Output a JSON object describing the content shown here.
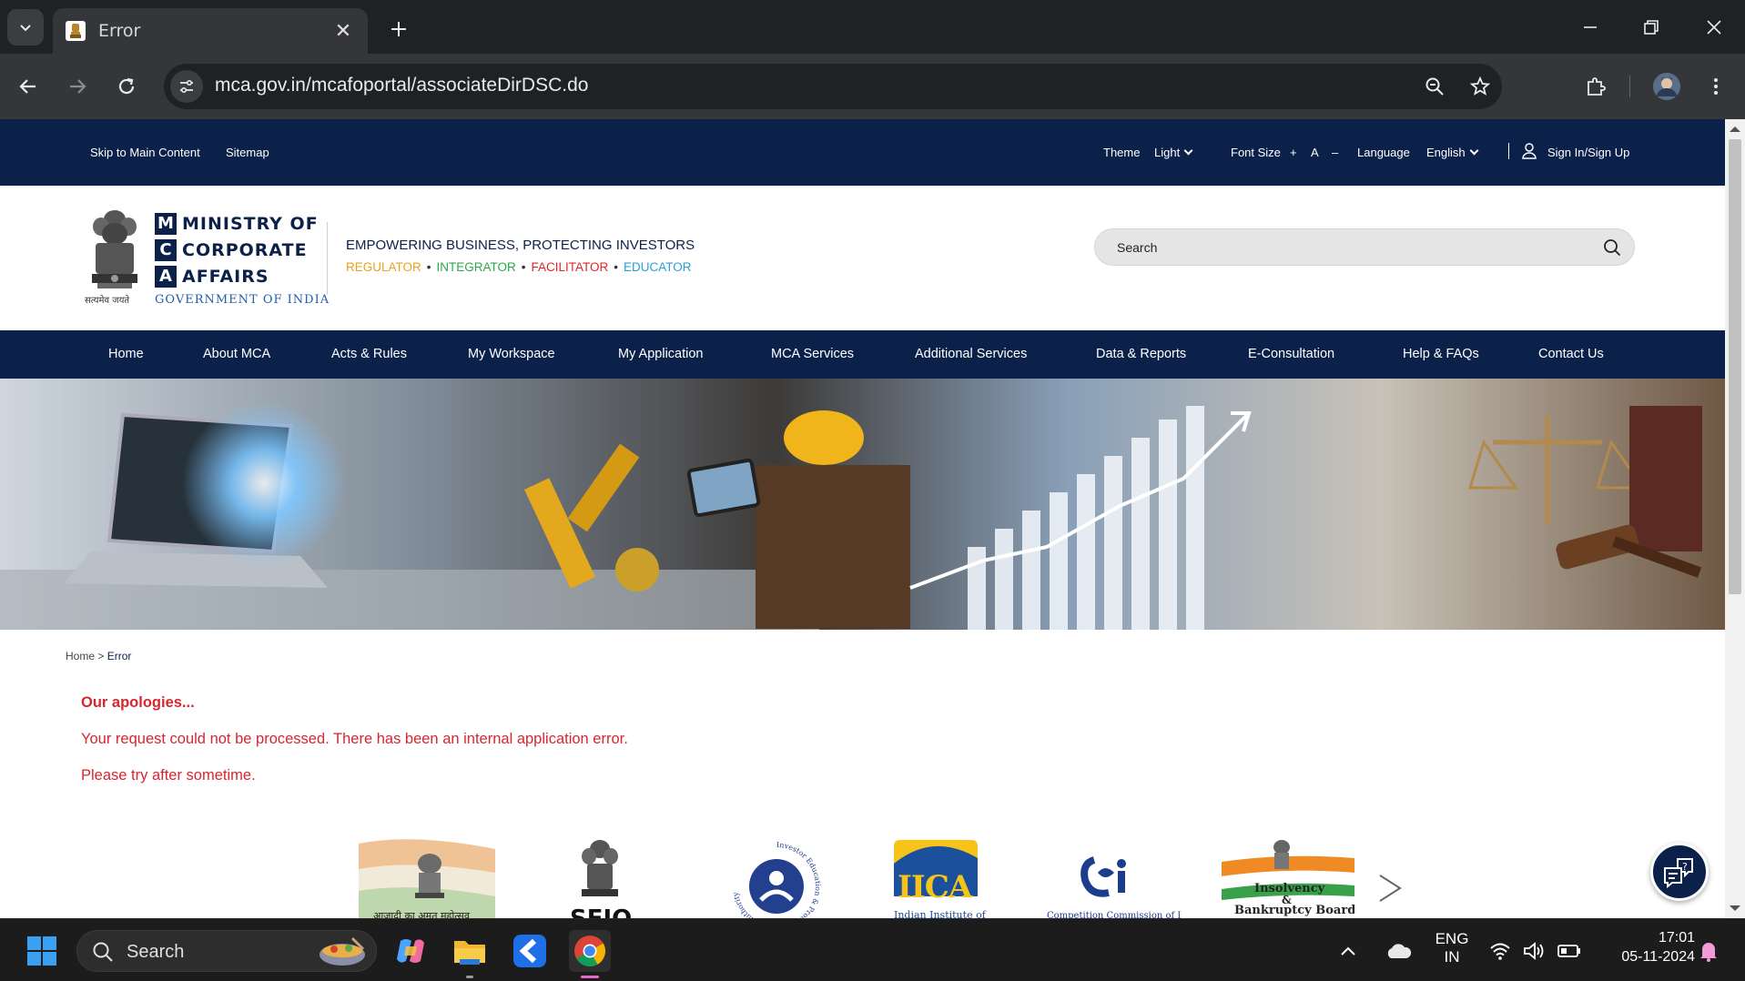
{
  "browser": {
    "tab_title": "Error",
    "url": "mca.gov.in/mcafoportal/associateDirDSC.do"
  },
  "topstrip": {
    "skip_link": "Skip to Main Content",
    "sitemap": "Sitemap",
    "theme_label": "Theme",
    "theme_value": "Light",
    "font_size_label": "Font Size",
    "font_plus": "+",
    "font_normal": "A",
    "font_minus": "–",
    "language_label": "Language",
    "language_value": "English",
    "signin": "Sign In/Sign Up"
  },
  "header": {
    "logo_words": [
      "MINISTRY OF",
      "CORPORATE",
      "AFFAIRS"
    ],
    "logo_letters": [
      "M",
      "C",
      "A"
    ],
    "logo_gov": "GOVERNMENT OF INDIA",
    "emblem_motto": "सत्यमेव जयते",
    "tagline": "EMPOWERING BUSINESS, PROTECTING INVESTORS",
    "roles": [
      {
        "label": "REGULATOR",
        "color": "#e8a21c"
      },
      {
        "label": "INTEGRATOR",
        "color": "#2aa84a"
      },
      {
        "label": "FACILITATOR",
        "color": "#e0242d"
      },
      {
        "label": "EDUCATOR",
        "color": "#2a9fd6"
      }
    ],
    "search_placeholder": "Search"
  },
  "nav": [
    "Home",
    "About MCA",
    "Acts & Rules",
    "My Workspace",
    "My Application",
    "MCA Services",
    "Additional Services",
    "Data & Reports",
    "E-Consultation",
    "Help & FAQs",
    "Contact Us"
  ],
  "breadcrumb": {
    "home": "Home",
    "sep": ">",
    "current": "Error"
  },
  "error": {
    "title": "Our apologies...",
    "line1": "Your request could not be processed. There has been an internal application error.",
    "line2": "Please try after sometime."
  },
  "partners": {
    "sfio": "SFIO",
    "iica": "IICA",
    "iica_sub": "Indian Institute of",
    "cci_sub": "Competition Commission of India",
    "ibbi_line1": "Insolvency",
    "ibbi_amp": "&",
    "ibbi_line2": "Bankruptcy Board",
    "iepf_ring": "Investor Education & Protection Fund Authority",
    "azadi": "आज़ादी का अमृत महोत्सव"
  },
  "taskbar": {
    "search": "Search",
    "lang_top": "ENG",
    "lang_bottom": "IN",
    "time": "17:01",
    "date": "05-11-2024"
  },
  "colors": {
    "navy": "#0b2149",
    "error_red": "#d8262e",
    "chrome_dark": "#202124",
    "chrome_mid": "#35363a"
  }
}
